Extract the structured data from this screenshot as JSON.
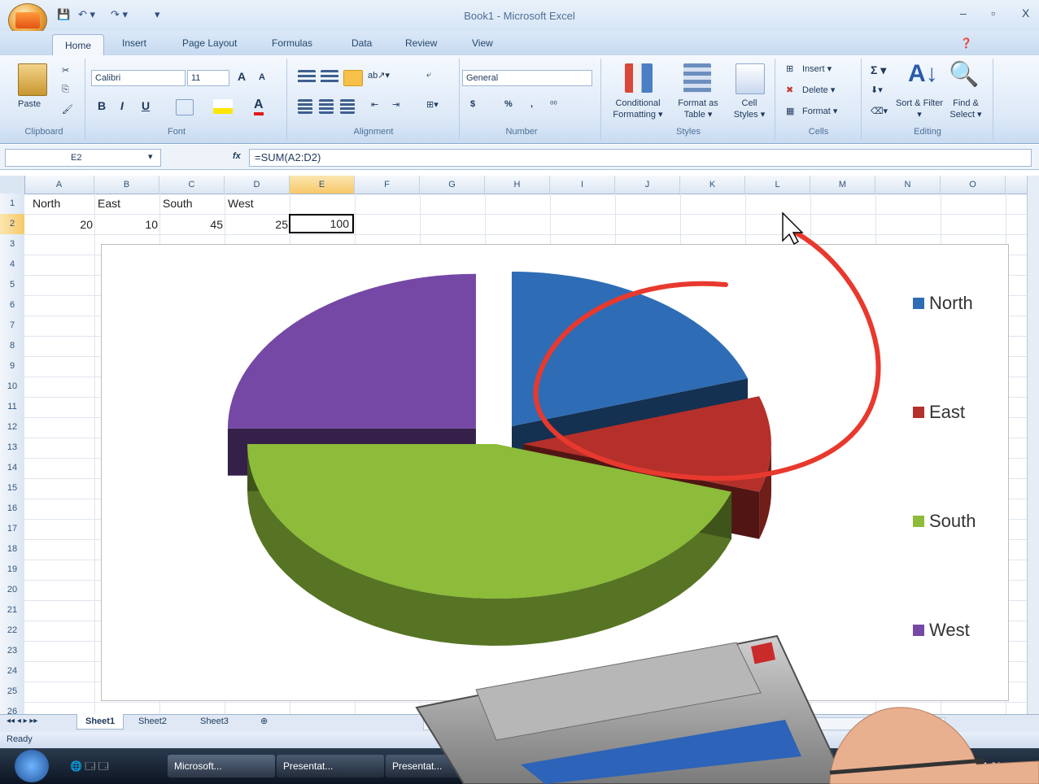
{
  "window": {
    "title": "Book1 - Microsoft Excel",
    "min": "–",
    "max": "▫",
    "close": "X"
  },
  "qat": {
    "save": "💾",
    "undo": "↶ ▾",
    "redo": "↷ ▾",
    "more": "▾"
  },
  "tabs": [
    "Home",
    "Insert",
    "Page Layout",
    "Formulas",
    "Data",
    "Review",
    "View"
  ],
  "ribbon": {
    "clipboard": {
      "paste": "Paste",
      "label": "Clipboard"
    },
    "font": {
      "name": "Calibri",
      "size": "11",
      "grow": "A",
      "shrink": "A",
      "bold": "B",
      "italic": "I",
      "underline": "U",
      "color": "A",
      "label": "Font"
    },
    "alignment": {
      "label": "Alignment"
    },
    "number": {
      "format": "General",
      "currency": "$",
      "percent": "%",
      "comma": ",",
      "inc": "⁰⁰",
      "label": "Number"
    },
    "styles": {
      "conditional": "Conditional Formatting ▾",
      "format_table": "Format as Table ▾",
      "cell_styles": "Cell Styles ▾",
      "label": "Styles"
    },
    "cells": {
      "insert": "Insert ▾",
      "delete": "Delete ▾",
      "format": "Format ▾",
      "label": "Cells"
    },
    "editing": {
      "sum": "Σ ▾",
      "sort": "Sort & Filter ▾",
      "find": "Find & Select ▾",
      "label": "Editing"
    }
  },
  "formula_bar": {
    "name_box": "E2",
    "fx": "fx",
    "formula": "=SUM(A2:D2)"
  },
  "columns": [
    "A",
    "B",
    "C",
    "D",
    "E",
    "F",
    "G",
    "H",
    "I",
    "J",
    "K",
    "L",
    "M",
    "N",
    "O"
  ],
  "rows": [
    "1",
    "2",
    "3",
    "4",
    "5",
    "6",
    "7",
    "8",
    "9",
    "10",
    "11",
    "12",
    "13",
    "14",
    "15",
    "16",
    "17",
    "18",
    "19",
    "20",
    "21",
    "22",
    "23",
    "24",
    "25",
    "26"
  ],
  "cells": {
    "A1": "North",
    "B1": "East",
    "C1": "South",
    "D1": "West",
    "A2": "20",
    "B2": "10",
    "C2": "45",
    "D2": "25",
    "E2": "100"
  },
  "chart_data": {
    "type": "pie",
    "categories": [
      "North",
      "East",
      "South",
      "West"
    ],
    "values": [
      20,
      10,
      45,
      25
    ],
    "colors": [
      "#2e6db5",
      "#b5302a",
      "#8dbb3a",
      "#7648a5"
    ],
    "legend": "right",
    "exploded": true,
    "style": "3d"
  },
  "sheets": {
    "nav": "◂◂ ◂ ▸ ▸▸",
    "tabs": [
      "Sheet1",
      "Sheet2",
      "Sheet3"
    ]
  },
  "status": "Ready",
  "taskbar": {
    "items": [
      "Microsoft...",
      "Presentat...",
      "Presentat..."
    ],
    "clock": "1:20 PM"
  },
  "colors": {
    "annotation": "#e8392e",
    "ribbon": "#dde9f7"
  }
}
